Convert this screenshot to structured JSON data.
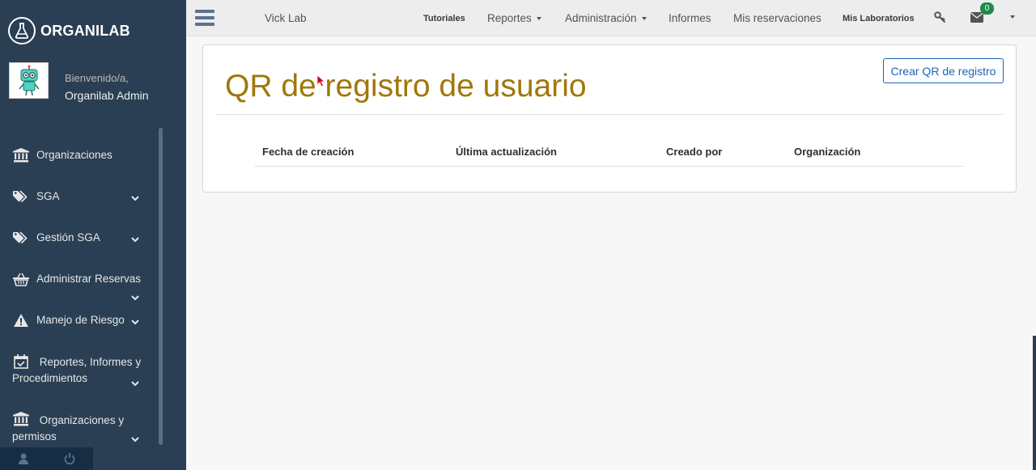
{
  "brand": {
    "name": "ORGANILAB",
    "icon": "flask-icon"
  },
  "profile": {
    "greeting": "Bienvenido/a,",
    "user_name": "Organilab Admin",
    "avatar_icon": "robot-avatar"
  },
  "sidebar": {
    "items": [
      {
        "label": "Organizaciones",
        "icon": "institution-icon",
        "expandable": false
      },
      {
        "label": "SGA",
        "icon": "tags-icon",
        "expandable": true
      },
      {
        "label": "Gestión SGA",
        "icon": "tags-icon",
        "expandable": true
      },
      {
        "label": "Administrar Reservas",
        "icon": "basket-icon",
        "expandable": true
      },
      {
        "label": "Manejo de Riesgo",
        "icon": "warning-icon",
        "expandable": true
      },
      {
        "label": "Reportes, Informes y Procedimientos",
        "icon": "calendar-check-icon",
        "expandable": true
      },
      {
        "label": "Organizaciones y permisos",
        "icon": "institution-icon",
        "expandable": true
      }
    ],
    "footer": [
      "user-icon",
      "power-icon"
    ]
  },
  "topnav": {
    "lab_name": "Vick Lab",
    "tutoriales": "Tutoriales",
    "reportes": "Reportes",
    "administracion": "Administración",
    "informes": "Informes",
    "mis_reservaciones": "Mis reservaciones",
    "mis_laboratorios": "Mis Laboratorios",
    "messages_count": "0"
  },
  "main": {
    "title": "QR de registro de usuario",
    "create_button": "Crear QR de registro",
    "table": {
      "columns": [
        "Fecha de creación",
        "Última actualización",
        "Creado por",
        "Organización"
      ],
      "rows": []
    }
  },
  "colors": {
    "sidebar": "#2a3f54",
    "title": "#a0770b",
    "button": "#1a64b8",
    "badge": "#1d8c4a"
  }
}
